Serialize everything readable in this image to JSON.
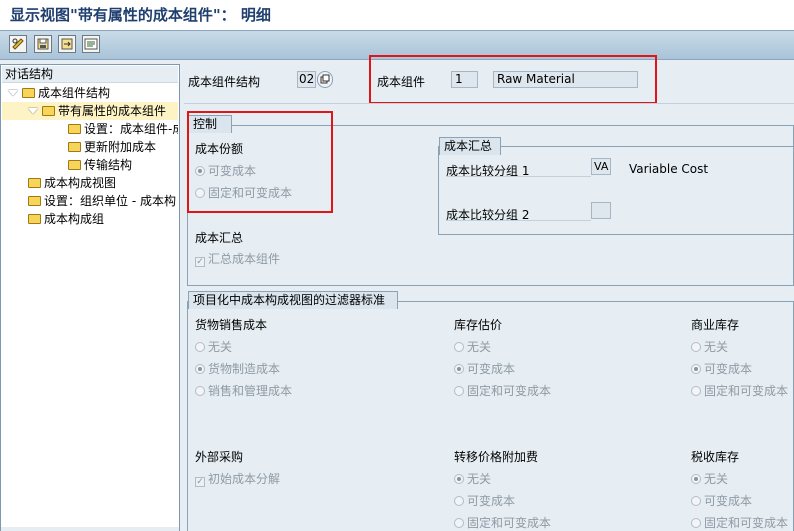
{
  "title": "显示视图\"带有属性的成本组件\"： 明细",
  "toolbar": {
    "buttons": [
      "edit-glasses-icon",
      "save-icon",
      "export-icon",
      "details-icon"
    ]
  },
  "tree": {
    "header": "对话结构",
    "items": [
      {
        "label": "成本组件结构",
        "level": 0,
        "expanded": true
      },
      {
        "label": "带有属性的成本组件",
        "level": 1,
        "expanded": true,
        "selected": true
      },
      {
        "label": "设置：成本组件-成",
        "level": 2
      },
      {
        "label": "更新附加成本",
        "level": 2
      },
      {
        "label": "传输结构",
        "level": 2
      },
      {
        "label": "成本构成视图",
        "level": 0
      },
      {
        "label": "设置：组织单位 - 成本构",
        "level": 0
      },
      {
        "label": "成本构成组",
        "level": 0
      }
    ]
  },
  "header_fields": {
    "structure_label": "成本组件结构",
    "structure_value": "02",
    "component_label": "成本组件",
    "component_value": "1",
    "component_desc": "Raw Material"
  },
  "control": {
    "tab": "控制",
    "cost_share_label": "成本份额",
    "options": [
      "可变成本",
      "固定和可变成本"
    ],
    "selected": 0,
    "summary_label": "成本汇总",
    "summary_check": "汇总成本组件",
    "summary_checked": true
  },
  "cost_summary": {
    "tab": "成本汇总",
    "group1_label": "成本比较分组 1",
    "group1_value": "VA",
    "group1_desc": "Variable Cost",
    "group2_label": "成本比较分组 2",
    "group2_value": ""
  },
  "filter": {
    "tab": "项目化中成本构成视图的过滤器标准",
    "sections": [
      {
        "title": "货物销售成本",
        "options": [
          "无关",
          "货物制造成本",
          "销售和管理成本"
        ],
        "selected": 1
      },
      {
        "title": "库存估价",
        "options": [
          "无关",
          "可变成本",
          "固定和可变成本"
        ],
        "selected": 1
      },
      {
        "title": "商业库存",
        "options": [
          "无关",
          "可变成本",
          "固定和可变成本"
        ],
        "selected": 1
      },
      {
        "title": "外部采购",
        "check": "初始成本分解",
        "checked": true
      },
      {
        "title": "转移价格附加费",
        "options": [
          "无关",
          "可变成本",
          "固定和可变成本"
        ],
        "selected": 0
      },
      {
        "title": "税收库存",
        "options": [
          "无关",
          "可变成本",
          "固定和可变成本"
        ],
        "selected": 0
      }
    ]
  },
  "colors": {
    "highlight": "#e01616",
    "title": "#1f3f6e",
    "background": "#e6eef3"
  }
}
